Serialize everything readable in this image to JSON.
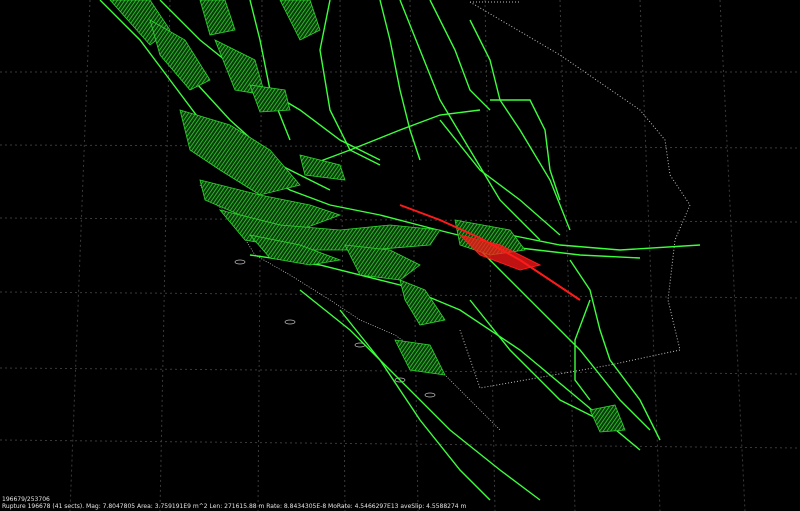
{
  "scene": {
    "background": "#000000",
    "grid_color": "#3a3a3a",
    "outline_color": "#bfbfbf",
    "fault_color": "#2ed62e",
    "fault_bright": "#3cff3c",
    "rupture_color": "#ff1a1a",
    "icons": [
      "fault-section-icon",
      "rupture-icon",
      "coastline-icon",
      "state-boundary-icon"
    ]
  },
  "status": {
    "counter": "196679/253706",
    "info": "Rupture 196678 (41 sects). Mag: 7.8047805 Area: 3.759191E9 m^2 Len: 271615.88 m Rate: 8.8434305E-8 MoRate: 4.5466297E13 aveSlip: 4.5588274 m"
  }
}
